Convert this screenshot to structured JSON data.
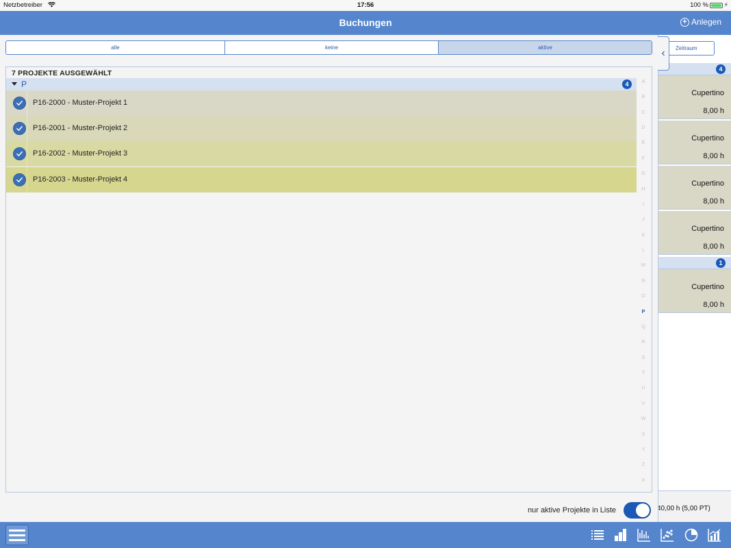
{
  "status_bar": {
    "carrier": "Netzbetreiber",
    "time": "17:56",
    "battery": "100 %"
  },
  "nav": {
    "title": "Buchungen",
    "add_label": "Anlegen"
  },
  "segment": {
    "options": [
      "alle",
      "keine",
      "aktive"
    ],
    "selected": "aktive"
  },
  "list": {
    "count_label": "7 PROJEKTE AUSGEWÄHLT",
    "section": {
      "letter": "P",
      "badge": "4"
    },
    "rows": [
      {
        "label": "P16-2000 - Muster-Projekt 1",
        "bg": "#d9d8c7"
      },
      {
        "label": "P16-2001 - Muster-Projekt 2",
        "bg": "#d9d9b9"
      },
      {
        "label": "P16-2002 - Muster-Projekt 3",
        "bg": "#d9d9a3"
      },
      {
        "label": "P16-2003 - Muster-Projekt 4",
        "bg": "#d7d68f"
      }
    ],
    "index_letters": [
      "A",
      "B",
      "C",
      "D",
      "E",
      "F",
      "G",
      "H",
      "I",
      "J",
      "K",
      "L",
      "M",
      "N",
      "O",
      "P",
      "Q",
      "R",
      "S",
      "T",
      "U",
      "V",
      "W",
      "X",
      "Y",
      "Z",
      "#"
    ],
    "active_index": "P"
  },
  "toggle": {
    "label": "nur aktive Projekte in Liste",
    "on": true
  },
  "right_panel": {
    "zeitraum_label": "Zeitraum",
    "group1_badge": "4",
    "group2_badge": "1",
    "cards": [
      {
        "city": "Cupertino",
        "hours": "8,00 h"
      },
      {
        "city": "Cupertino",
        "hours": "8,00 h"
      },
      {
        "city": "Cupertino",
        "hours": "8,00 h"
      },
      {
        "city": "Cupertino",
        "hours": "8,00 h"
      },
      {
        "city": "Cupertino",
        "hours": "8,00 h"
      }
    ],
    "total": "40,00 h (5,00 PT)"
  },
  "toolbar": {
    "icons": [
      "list-icon",
      "bar-chart-icon",
      "line-chart-icon",
      "scatter-chart-icon",
      "pie-chart-icon",
      "combo-chart-icon"
    ]
  },
  "colors": {
    "nav_blue": "#5585cc",
    "accent_blue": "#1a59b5",
    "section_bg": "#d5e0f1"
  }
}
